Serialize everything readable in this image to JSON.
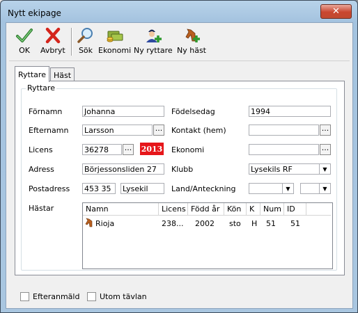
{
  "window": {
    "title": "Nytt ekipage",
    "close_glyph": "✕"
  },
  "toolbar": {
    "items": [
      {
        "label": "OK",
        "icon": "checkmark-icon"
      },
      {
        "label": "Avbryt",
        "icon": "cancel-x-icon"
      },
      {
        "label": "Sök",
        "icon": "magnifier-icon"
      },
      {
        "label": "Ekonomi",
        "icon": "money-icon"
      },
      {
        "label": "Ny ryttare",
        "icon": "add-rider-icon"
      },
      {
        "label": "Ny häst",
        "icon": "add-horse-icon"
      }
    ]
  },
  "tabs": [
    {
      "label": "Ryttare",
      "active": true
    },
    {
      "label": "Häst",
      "active": false
    }
  ],
  "rider": {
    "group_label": "Ryttare",
    "fornamn_label": "Förnamn",
    "fornamn_value": "Johanna",
    "efternamn_label": "Efternamn",
    "efternamn_value": "Larsson",
    "licens_label": "Licens",
    "licens_value": "36278",
    "licens_year": "2013",
    "adress_label": "Adress",
    "adress_value": "Börjessonsliden 27",
    "postadress_label": "Postadress",
    "postnummer_value": "453 35",
    "ort_value": "Lysekil",
    "hastar_label": "Hästar",
    "fodelsedag_label": "Födelsedag",
    "fodelsedag_value": "1994",
    "kontakt_label": "Kontakt (hem)",
    "kontakt_value": "",
    "ekonomi_label": "Ekonomi",
    "ekonomi_value": "",
    "klubb_label": "Klubb",
    "klubb_value": "Lysekils RF",
    "land_label": "Land/Anteckning",
    "land_value": "",
    "anteckning_value": "",
    "browse_glyph": "...",
    "dropdown_glyph": "▼"
  },
  "horses_table": {
    "columns": [
      "Namn",
      "Licens",
      "Född år",
      "Kön",
      "K",
      "Num",
      "ID"
    ],
    "rows": [
      {
        "name": "Rioja",
        "licens": "238...",
        "fodd": "2002",
        "kon": "sto",
        "k": "H",
        "num": "51",
        "id": "51"
      }
    ]
  },
  "footer": {
    "efteranmald_label": "Efteranmäld",
    "efteranmald_checked": false,
    "utom_tavlan_label": "Utom tävlan",
    "utom_tavlan_checked": false
  },
  "colors": {
    "title_bar": "#a9c6e0",
    "license_badge": "#e6161a",
    "close_button": "#c9462f"
  }
}
